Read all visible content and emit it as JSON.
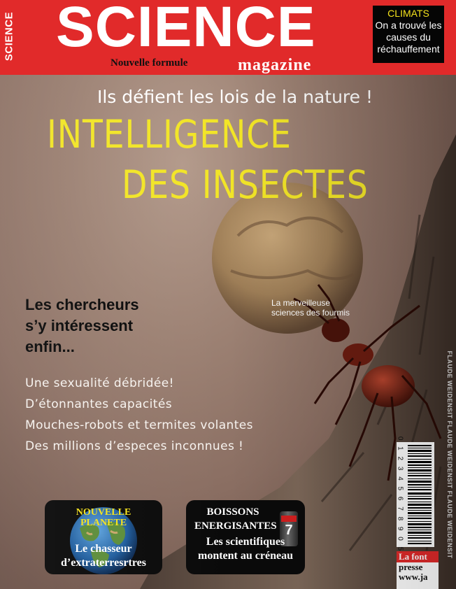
{
  "masthead": {
    "side_label": "SCIENCE",
    "logo": "SCIENCE",
    "tagline": "Nouvelle formule",
    "subtitle": "magazine",
    "climats": {
      "title": "CLIMATS",
      "lines": [
        "On a trouvé les",
        "causes du",
        "réchauffement"
      ]
    }
  },
  "headline": {
    "kicker": "Ils défient les lois de la nature !",
    "title_line1": "INTELLIGENCE",
    "title_line2": "DES INSECTES"
  },
  "image_caption": {
    "line1": "La merveilleuse",
    "line2": "sciences des fourmis"
  },
  "lead": {
    "line1": "Les chercheurs",
    "line2": "s’y intéressent",
    "line3": "enfin..."
  },
  "bullets": [
    "Une sexualité débridée!",
    "D’étonnantes capacités",
    "Mouches-robots et termites volantes",
    "Des millions d’especes inconnues !"
  ],
  "teaser_planet": {
    "head_line1": "NOUVELLE",
    "head_line2": "PLANETE",
    "text_line1": "Le  chasseur",
    "text_line2": "d’extraterresrtres"
  },
  "teaser_drinks": {
    "head_line1": "BOISSONS",
    "head_line2": "ENERGISANTES",
    "text_line1": "Les scientifiques",
    "text_line2": "montent au créneau",
    "can_number": "7"
  },
  "barcode": {
    "digits": "0 1 2 3 4 5 6 7 8 9 0 5",
    "vertical_text": "FLAUDE WEIDENSIT FLAUDE WEIDENSIT FLAUDE WEIDENSIT"
  },
  "press": {
    "line1": "La font",
    "line2": "presse",
    "line3": "www.ja"
  },
  "colors": {
    "masthead_red": "#e12a2a",
    "headline_yellow": "#f2e527",
    "climats_yellow": "#f4e21c"
  }
}
